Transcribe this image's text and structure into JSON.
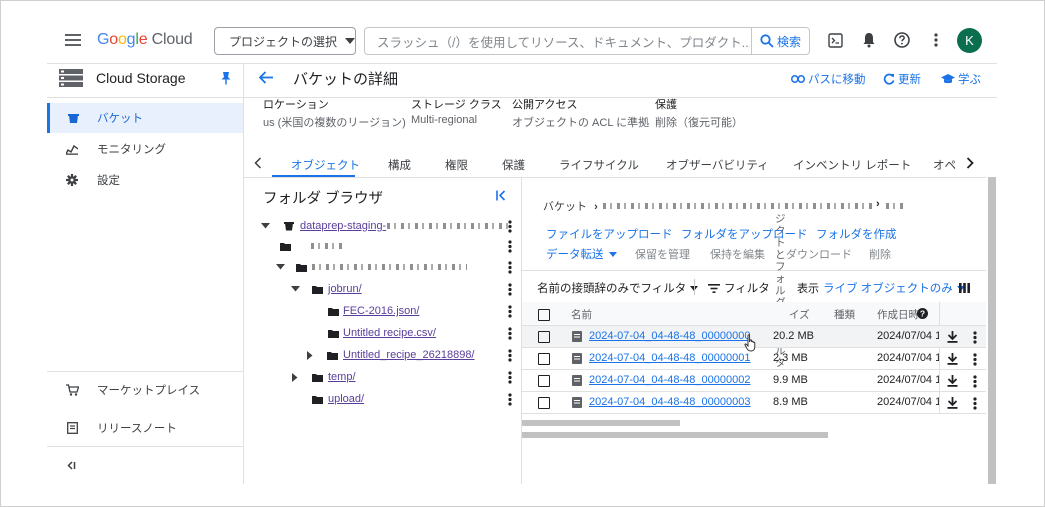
{
  "topbar": {
    "logo": {
      "g1": "G",
      "g2": "o",
      "g3": "o",
      "g4": "g",
      "g5": "l",
      "g6": "e",
      "cloud": " Cloud"
    },
    "project_selector": "プロジェクトの選択",
    "search_placeholder": "スラッシュ（/）を使用してリソース、ドキュメント、プロダクト...",
    "search_button": "検索",
    "avatar_initial": "K"
  },
  "nav": {
    "title": "Cloud Storage",
    "items": [
      {
        "label": "バケット",
        "icon": "bucket-icon"
      },
      {
        "label": "モニタリング",
        "icon": "monitoring-icon"
      },
      {
        "label": "設定",
        "icon": "settings-icon"
      }
    ],
    "bottom": [
      {
        "label": "マーケットプレイス",
        "icon": "marketplace-icon"
      },
      {
        "label": "リリースノート",
        "icon": "release-notes-icon"
      }
    ]
  },
  "header": {
    "title": "バケットの詳細",
    "actions": [
      "パスに移動",
      "更新",
      "学ぶ"
    ]
  },
  "info": {
    "labels": [
      "ロケーション",
      "ストレージ クラス",
      "公開アクセス",
      "保護"
    ],
    "values": [
      "us (米国の複数のリージョン)",
      "Multi-regional",
      "オブジェクトの ACL に準拠",
      "削除（復元可能）"
    ]
  },
  "tabs": [
    "オブジェクト",
    "構成",
    "権限",
    "保護",
    "ライフサイクル",
    "オブザーバビリティ",
    "インベントリ レポート",
    "オペレ"
  ],
  "folder_browser": {
    "title": "フォルダ ブラウザ",
    "tree": [
      {
        "label": "dataprep-staging-",
        "kind": "bucket"
      },
      {
        "label": "",
        "kind": "folder"
      },
      {
        "label": "",
        "kind": "folder"
      },
      {
        "label": "jobrun/",
        "kind": "folder"
      },
      {
        "label": "FEC-2016.json/",
        "kind": "folder"
      },
      {
        "label": "Untitled recipe.csv/",
        "kind": "folder"
      },
      {
        "label": "Untitled_recipe_26218898/",
        "kind": "folder"
      },
      {
        "label": "temp/",
        "kind": "folder"
      },
      {
        "label": "upload/",
        "kind": "folder"
      }
    ]
  },
  "objects": {
    "breadcrumb": "バケット",
    "actions": [
      "ファイルをアップロード",
      "フォルダをアップロード",
      "フォルダを作成",
      "データ転送"
    ],
    "grey_actions": [
      "保留を管理",
      "保持を編集",
      "ダウンロード",
      "削除"
    ],
    "vertical_text": "ジクトとフォルダをフィルタ",
    "filter_prefix": "名前の接頭辞のみでフィルタ",
    "filter": "フィルタ",
    "display_label": "表示",
    "display_value": "ライブ オブジェクトのみ",
    "columns": [
      "名前",
      "イズ",
      "種類",
      "作成日時"
    ],
    "rows": [
      {
        "name": "2024-07-04_04-48-48_00000000",
        "size": "20.2 MB",
        "created": "2024/07/04 1:"
      },
      {
        "name": "2024-07-04_04-48-48_00000001",
        "size": "2.3 MB",
        "created": "2024/07/04 1:"
      },
      {
        "name": "2024-07-04_04-48-48_00000002",
        "size": "9.9 MB",
        "created": "2024/07/04 1:"
      },
      {
        "name": "2024-07-04_04-48-48_00000003",
        "size": "8.9 MB",
        "created": "2024/07/04 1:"
      }
    ]
  },
  "colors": {
    "accent": "#1a73e8",
    "folder_link": "#5a3e9b",
    "avatar": "#0b6e4f"
  }
}
